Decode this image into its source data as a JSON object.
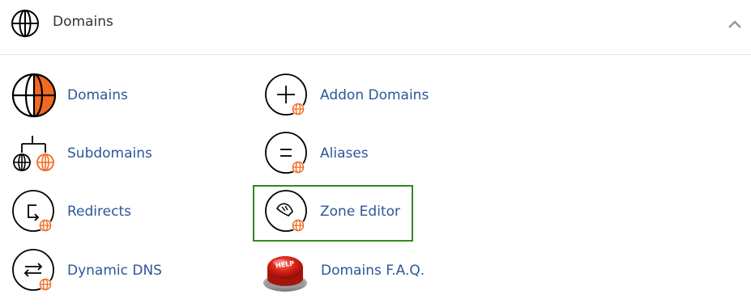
{
  "section": {
    "title": "Domains",
    "icon": "globe-icon",
    "collapse_icon": "chevron-up-icon"
  },
  "items": [
    {
      "label": "Domains",
      "icon": "globe-icon"
    },
    {
      "label": "Addon Domains",
      "icon": "addon-domains-icon"
    },
    {
      "label": "Subdomains",
      "icon": "subdomains-icon"
    },
    {
      "label": "Aliases",
      "icon": "aliases-icon"
    },
    {
      "label": "Redirects",
      "icon": "redirects-icon"
    },
    {
      "label": "Zone Editor",
      "icon": "zone-editor-icon"
    },
    {
      "label": "Dynamic DNS",
      "icon": "dynamic-dns-icon"
    },
    {
      "label": "Domains F.A.Q.",
      "icon": "help-button-icon"
    }
  ],
  "colors": {
    "link": "#2b5797",
    "accent_orange": "#f26a21",
    "highlight_border": "#2f8a1d"
  },
  "help_badge_text": "HELP"
}
